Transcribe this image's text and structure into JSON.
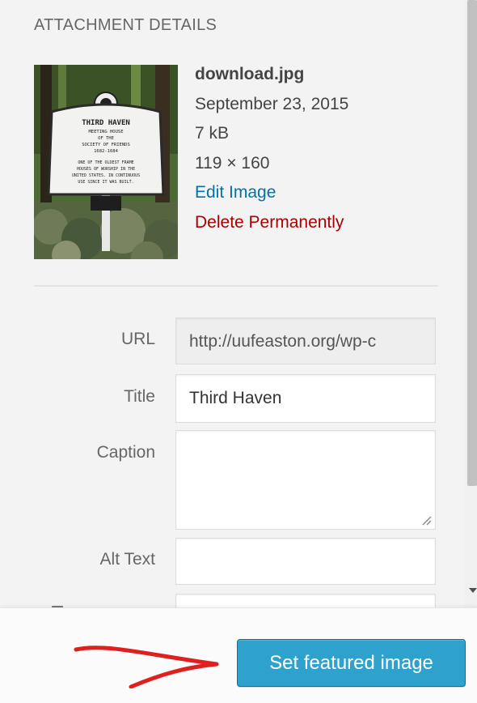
{
  "section": {
    "title": "ATTACHMENT DETAILS"
  },
  "attachment": {
    "filename": "download.jpg",
    "date": "September 23, 2015",
    "size": "7 kB",
    "dimensions": "119 × 160",
    "edit_link": "Edit Image",
    "delete_link": "Delete Permanently",
    "sign": {
      "heading": "THIRD HAVEN",
      "line2": "MEETING HOUSE",
      "line3": "OF THE",
      "line4": "SOCIETY OF FRIENDS",
      "line5": "1682-1684",
      "line6": "ONE OF THE OLDEST FRAME",
      "line7": "HOUSES OF WORSHIP IN THE",
      "line8": "UNITED STATES. IN CONTINUOUS",
      "line9": "USE SINCE IT WAS BUILT."
    }
  },
  "fields": {
    "url_label": "URL",
    "url_value": "http://uufeaston.org/wp-c",
    "title_label": "Title",
    "title_value": "Third Haven",
    "caption_label": "Caption",
    "caption_value": "",
    "alt_label": "Alt Text",
    "alt_value": ""
  },
  "footer": {
    "button_label": "Set featured image"
  },
  "colors": {
    "button": "#2ea2cc",
    "link": "#0073aa",
    "delete": "#aa0000",
    "annotation": "#e0201e"
  }
}
